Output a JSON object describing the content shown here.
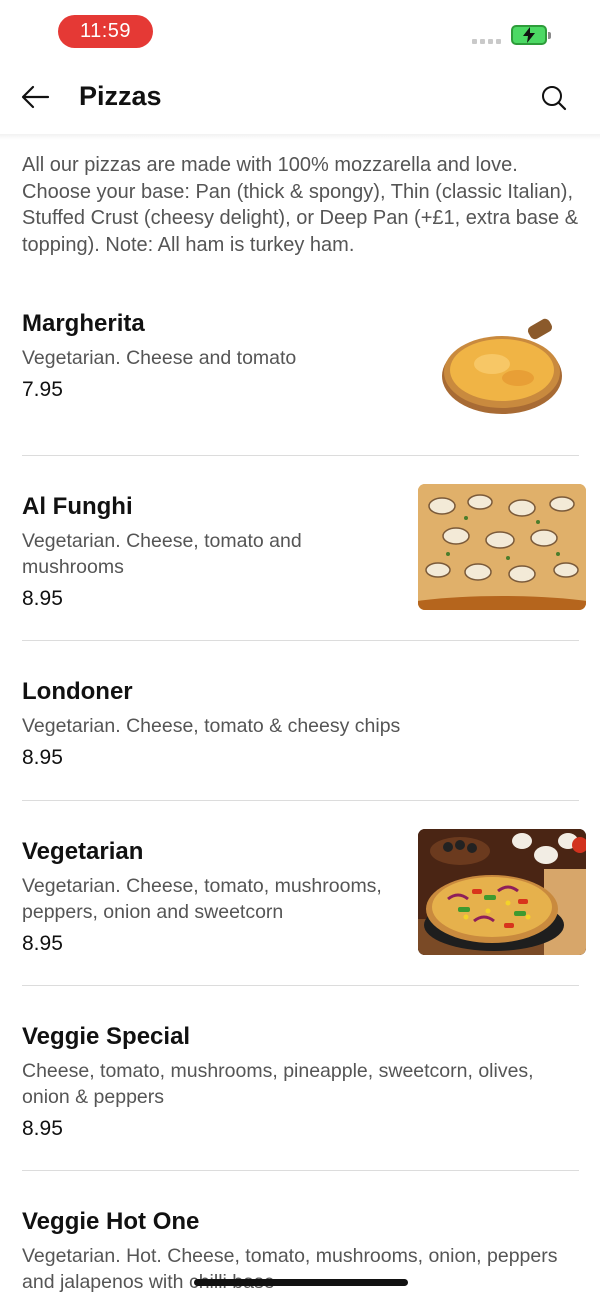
{
  "status_bar": {
    "time": "11:59"
  },
  "header": {
    "title": "Pizzas"
  },
  "intro": "All our pizzas are made with 100% mozzarella and love. Choose your base: Pan (thick & spongy), Thin (classic Italian), Stuffed Crust (cheesy delight), or Deep Pan (+£1, extra base & topping). Note: All ham is turkey ham.",
  "items": [
    {
      "name": "Margherita",
      "description": "Vegetarian. Cheese and tomato",
      "price": "7.95"
    },
    {
      "name": "Al Funghi",
      "description": "Vegetarian. Cheese, tomato and mushrooms",
      "price": "8.95"
    },
    {
      "name": "Londoner",
      "description": "Vegetarian. Cheese, tomato & cheesy chips",
      "price": "8.95"
    },
    {
      "name": "Vegetarian",
      "description": "Vegetarian. Cheese, tomato, mushrooms, peppers, onion and sweetcorn",
      "price": "8.95"
    },
    {
      "name": "Veggie Special",
      "description": "Cheese, tomato, mushrooms, pineapple, sweetcorn, olives, onion & peppers",
      "price": "8.95"
    },
    {
      "name": "Veggie Hot One",
      "description": "Vegetarian. Hot. Cheese, tomato, mushrooms, onion, peppers and jalapenos with chilli base"
    }
  ],
  "colors": {
    "accent": "#e53935",
    "battery": "#4cd964"
  }
}
